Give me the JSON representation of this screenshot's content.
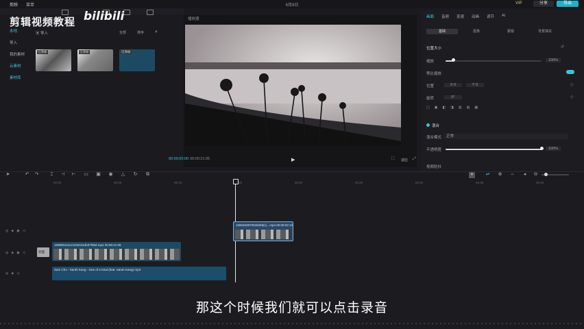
{
  "app": {
    "name": "剪映",
    "menu": "菜单",
    "project_title": "6月8日",
    "pro_badge": "VIP",
    "share_label": "分享",
    "export_label": "导出"
  },
  "watermark": {
    "text": "剪辑视频教程",
    "brand": "bilibili"
  },
  "left_nav": {
    "items": [
      {
        "label": "本地",
        "active": true
      },
      {
        "label": "导入",
        "active": false
      },
      {
        "label": "我的素材",
        "active": false
      },
      {
        "label": "云素材",
        "active": false
      },
      {
        "label": "素材库",
        "active": false
      }
    ],
    "import_label": "导入",
    "media_toolbar": [
      "全部",
      "排序"
    ]
  },
  "media_items": [
    {
      "badge": "已添加"
    },
    {
      "badge": "已添加"
    },
    {
      "badge": "已添加"
    }
  ],
  "player": {
    "title": "播放器",
    "time_current": "00:00:00:00",
    "time_total": "00:00:21:05",
    "ratio_label": "适应",
    "controls": [
      "play-icon",
      "crop-icon",
      "fullscreen-icon"
    ]
  },
  "inspector": {
    "tabs": [
      "画面",
      "音频",
      "变速",
      "动画",
      "调节",
      "AI"
    ],
    "active_tab": 0,
    "subtabs": [
      "基础",
      "抠像",
      "蒙版",
      "背景填充"
    ],
    "active_subtab": 0,
    "section_position": "位置大小",
    "scale_label": "缩放",
    "scale_value": "100%",
    "uniform_label": "等比缩放",
    "position_label": "位置",
    "position_x": "X 0",
    "position_y": "Y 0",
    "rotate_label": "旋转",
    "rotate_value": "0°",
    "blend_label": "混合",
    "blend_mode_label": "混合模式",
    "blend_mode_value": "正常",
    "opacity_label": "不透明度",
    "opacity_value": "100%",
    "scale_level": 0.08,
    "opacity_level": 1.0,
    "extra_label": "视频防抖"
  },
  "toolbar": {
    "icons": [
      "select-icon",
      "undo-icon",
      "redo-icon",
      "split-icon",
      "delete-icon",
      "freeze-icon",
      "reverse-icon",
      "mirror-icon",
      "rotate-icon",
      "crop-icon"
    ],
    "right_icons": [
      "record-icon",
      "link-icon",
      "preview-icon",
      "zoom-out-icon",
      "zoom-in-icon"
    ],
    "record_label": "录音"
  },
  "timeline": {
    "ruler": [
      "00:00",
      "00:05",
      "00:10",
      "00:15",
      "00:20",
      "00:25",
      "00:30",
      "00:35",
      "00:40",
      "00:45"
    ],
    "clip_sub_label": "16904039700262b9(1)...mp4  00:00:02:12",
    "clip_main_label": "1698001111131920154bd7f3bd.mp4  00:00:21:05",
    "clip_audio_label": "Sam Chu - Sarah Kang - One of a Kind (feat. Sarah Kang) mp3",
    "main_cover_label": "封面"
  },
  "subtitle": "那这个时候我们就可以点击录音",
  "colors": {
    "accent": "#38c6dd",
    "clip_blue": "#1d4a63",
    "export": "#23b0c8"
  }
}
